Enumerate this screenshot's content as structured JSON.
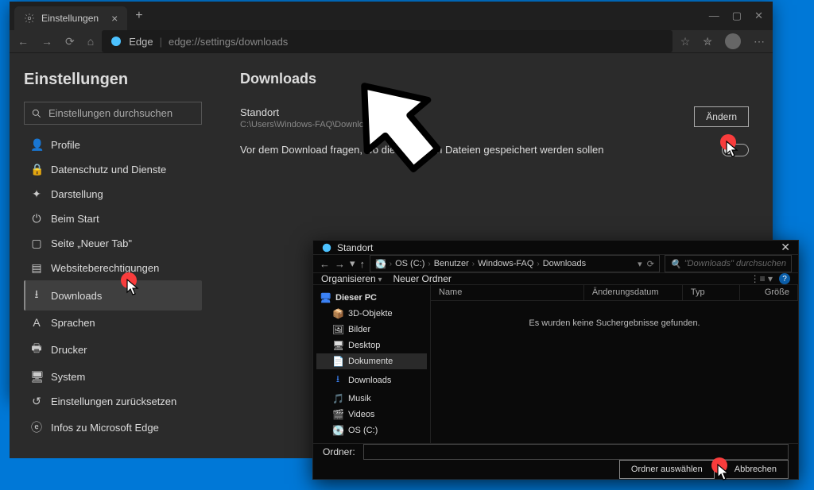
{
  "window": {
    "tab_title": "Einstellungen",
    "addr_prefix": "Edge",
    "addr_url": "edge://settings/downloads"
  },
  "sidebar": {
    "heading": "Einstellungen",
    "search_placeholder": "Einstellungen durchsuchen",
    "items": [
      {
        "label": "Profile",
        "icon": "👤"
      },
      {
        "label": "Datenschutz und Dienste",
        "icon": "🔒"
      },
      {
        "label": "Darstellung",
        "icon": "✦"
      },
      {
        "label": "Beim Start",
        "icon": "⏻"
      },
      {
        "label": "Seite „Neuer Tab\"",
        "icon": "▢"
      },
      {
        "label": "Websiteberechtigungen",
        "icon": "▤"
      },
      {
        "label": "Downloads",
        "icon": "⭳"
      },
      {
        "label": "Sprachen",
        "icon": "А"
      },
      {
        "label": "Drucker",
        "icon": "🖶"
      },
      {
        "label": "System",
        "icon": "🖥"
      },
      {
        "label": "Einstellungen zurücksetzen",
        "icon": "↺"
      },
      {
        "label": "Infos zu Microsoft Edge",
        "icon": "ⓔ"
      }
    ]
  },
  "content": {
    "heading": "Downloads",
    "location_label": "Standort",
    "location_path": "C:\\Users\\Windows-FAQ\\Downloads",
    "change_btn": "Ändern",
    "ask_label": "Vor dem Download fragen, wo die einzelnen Dateien gespeichert werden sollen"
  },
  "dialog": {
    "title": "Standort",
    "crumbs": [
      "OS (C:)",
      "Benutzer",
      "Windows-FAQ",
      "Downloads"
    ],
    "search_placeholder": "\"Downloads\" durchsuchen",
    "organize": "Organisieren",
    "new_folder": "Neuer Ordner",
    "tree_root": "Dieser PC",
    "tree_items": [
      {
        "label": "3D-Objekte",
        "icon": "📦"
      },
      {
        "label": "Bilder",
        "icon": "🖼"
      },
      {
        "label": "Desktop",
        "icon": "🖥"
      },
      {
        "label": "Dokumente",
        "icon": "📄"
      },
      {
        "label": "Downloads",
        "icon": "⭳"
      },
      {
        "label": "Musik",
        "icon": "🎵"
      },
      {
        "label": "Videos",
        "icon": "🎬"
      },
      {
        "label": "OS (C:)",
        "icon": "💽"
      }
    ],
    "cols": {
      "name": "Name",
      "date": "Änderungsdatum",
      "type": "Typ",
      "size": "Größe"
    },
    "empty": "Es wurden keine Suchergebnisse gefunden.",
    "folder_label": "Ordner:",
    "select_btn": "Ordner auswählen",
    "cancel_btn": "Abbrechen"
  }
}
